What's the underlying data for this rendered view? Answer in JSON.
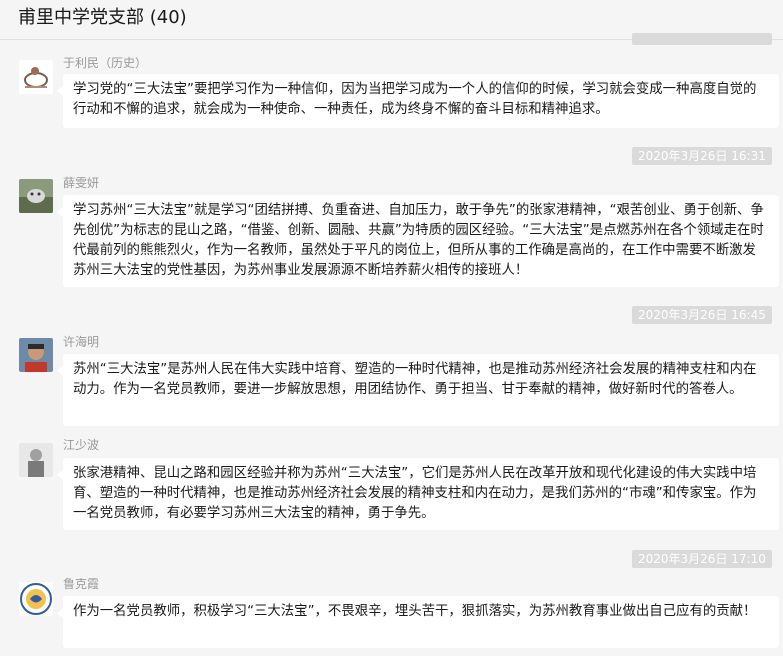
{
  "header": {
    "title": "甫里中学党支部 (40)"
  },
  "timestamps": [
    "2020年3月26日 16:31",
    "2020年3月26日 16:45",
    "2020年3月26日 17:10"
  ],
  "messages": [
    {
      "sender": "于利民（历史）",
      "text": "学习党的“三大法宝”要把学习作为一种信仰，因为当把学习成为一个人的信仰的时候，学习就会变成一种高度自觉的行动和不懈的追求，就会成为一种使命、一种责任，成为终身不懈的奋斗目标和精神追求。"
    },
    {
      "sender": "薛雯妍",
      "text": "学习苏州“三大法宝”就是学习“团结拼搏、负重奋进、自加压力，敢于争先”的张家港精神，“艰苦创业、勇于创新、争先创优”为标志的昆山之路，“借鉴、创新、圆融、共赢”为特质的园区经验。“三大法宝”是点燃苏州在各个领域走在时代最前列的熊熊烈火，作为一名教师，虽然处于平凡的岗位上，但所从事的工作确是高尚的，在工作中需要不断激发苏州三大法宝的党性基因，为苏州事业发展源源不断培养薪火相传的接班人！"
    },
    {
      "sender": "许海明",
      "text": "苏州“三大法宝”是苏州人民在伟大实践中培育、塑造的一种时代精神，也是推动苏州经济社会发展的精神支柱和内在动力。作为一名党员教师，要进一步解放思想，用团结协作、勇于担当、甘于奉献的精神，做好新时代的答卷人。"
    },
    {
      "sender": "江少波",
      "text": "张家港精神、昆山之路和园区经验并称为苏州“三大法宝”，它们是苏州人民在改革开放和现代化建设的伟大实践中培育、塑造的一种时代精神，也是推动苏州经济社会发展的精神支柱和内在动力，是我们苏州的“市魂”和传家宝。作为一名党员教师，有必要学习苏州三大法宝的精神，勇于争先。"
    },
    {
      "sender": "鲁克霞",
      "text": "作为一名党员教师，积极学习“三大法宝”，不畏艰辛，埋头苦干，狠抓落实，为苏州教育事业做出自己应有的贡献！"
    }
  ]
}
